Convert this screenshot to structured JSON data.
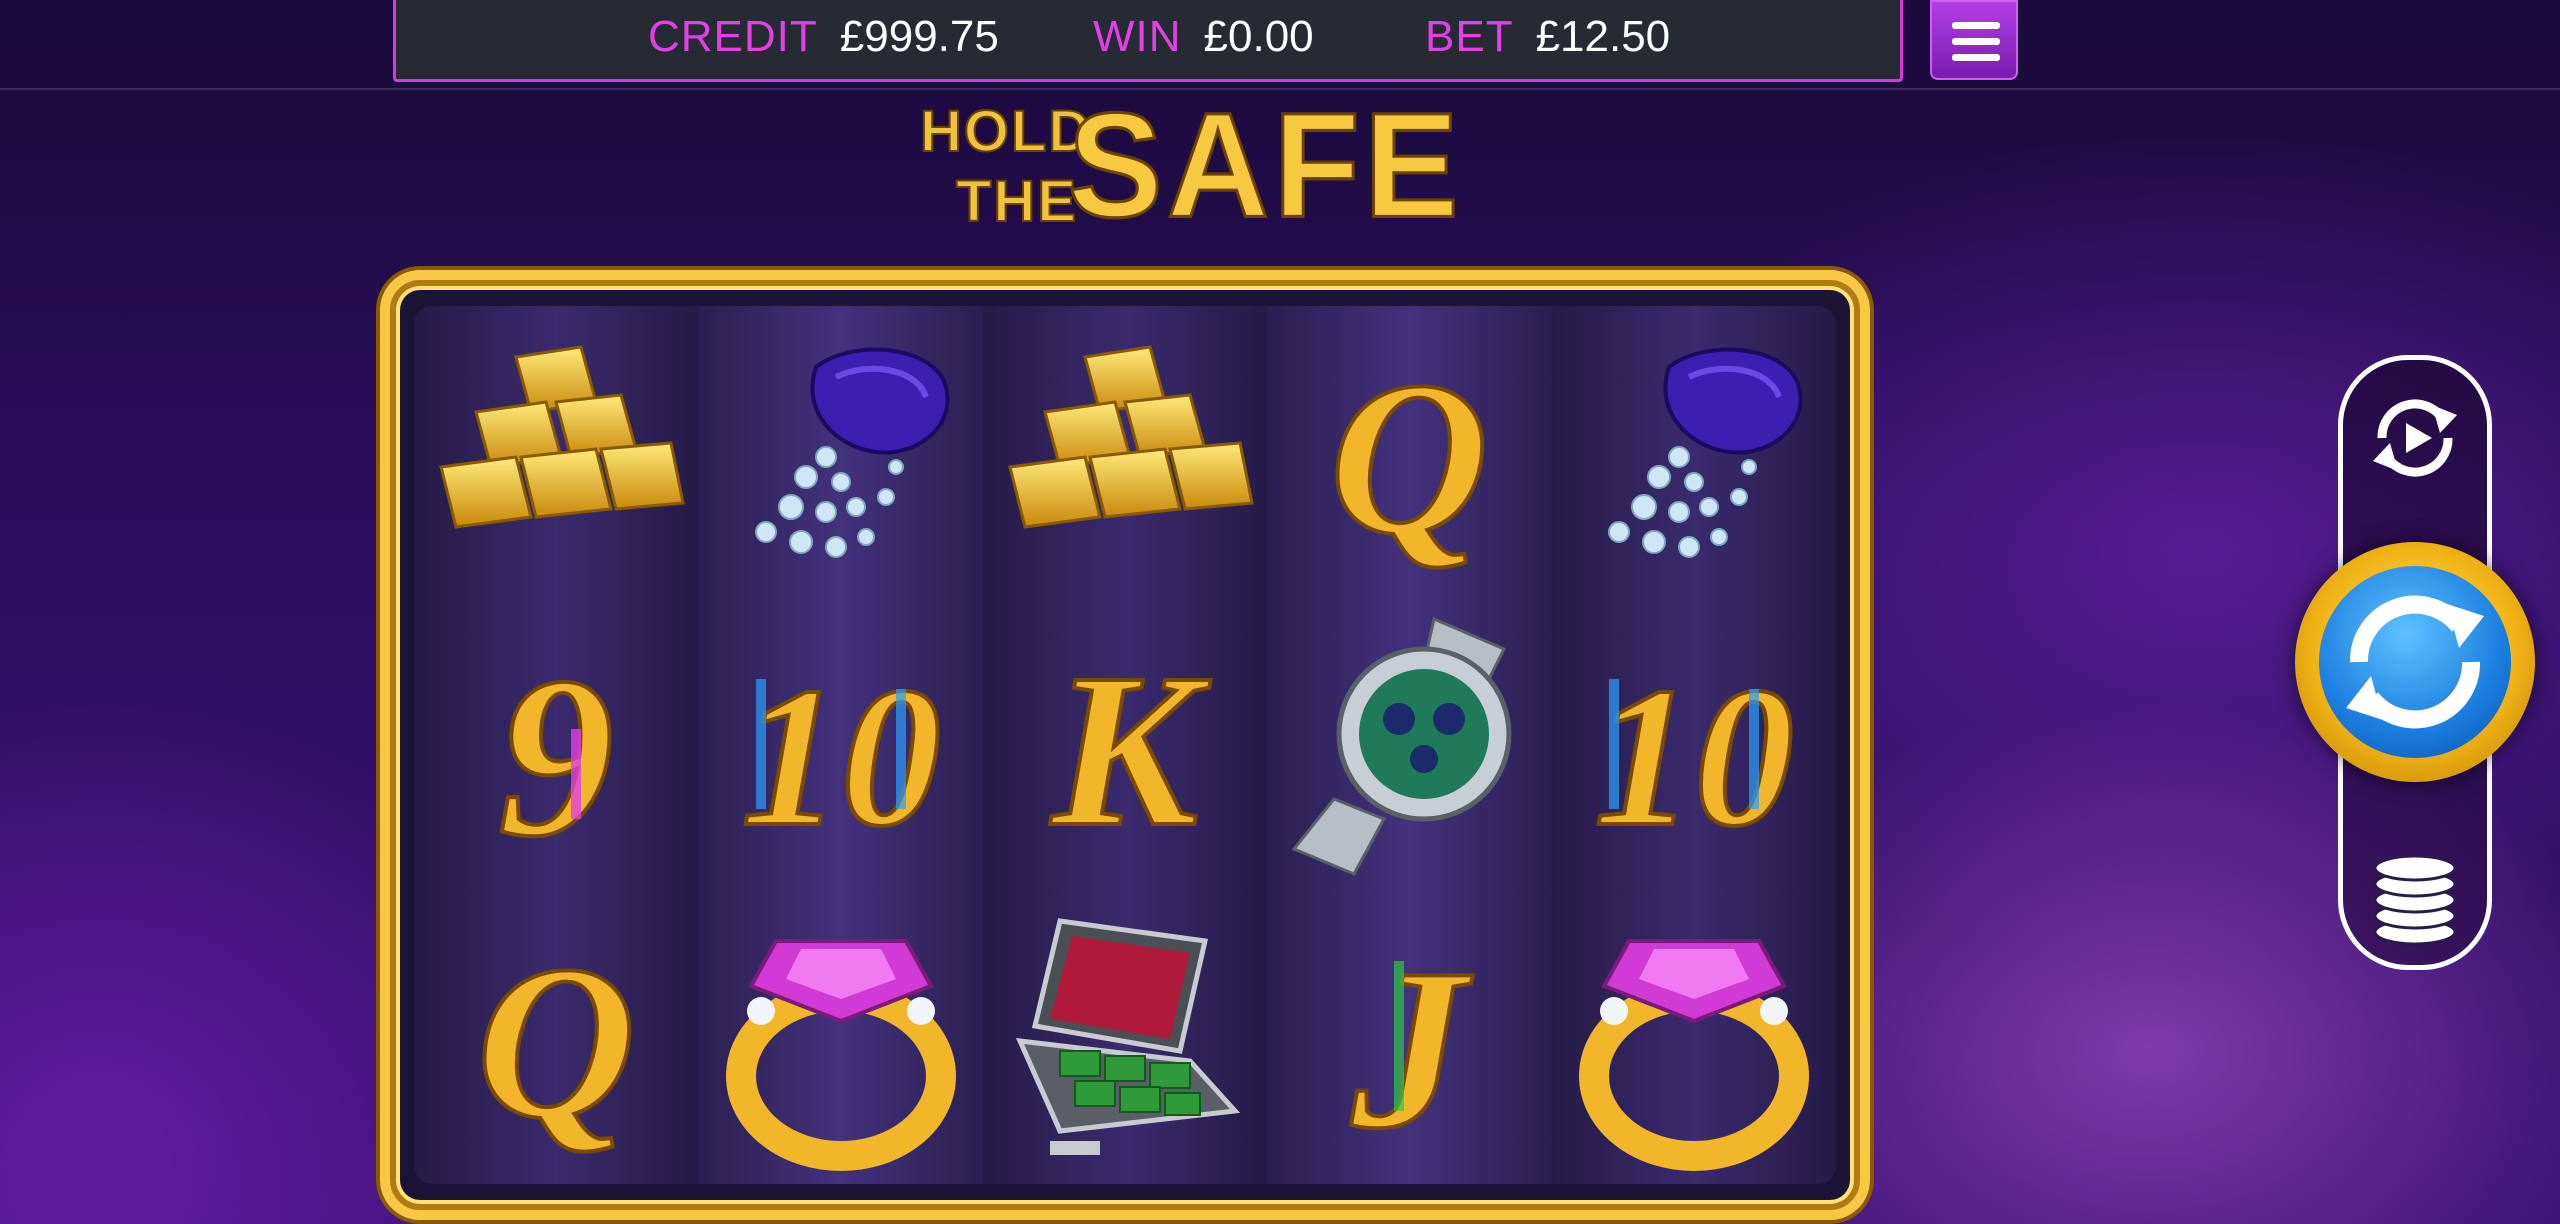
{
  "hud": {
    "credit_label": "CREDIT",
    "credit_value": "£999.75",
    "win_label": "WIN",
    "win_value": "£0.00",
    "bet_label": "BET",
    "bet_value": "£12.50"
  },
  "logo": {
    "line1": "HOLD",
    "line2": "THE",
    "word": "SAFE"
  },
  "reels": [
    [
      "gold-bars",
      "9",
      "Q"
    ],
    [
      "diamond-bag",
      "10",
      "ring"
    ],
    [
      "gold-bars",
      "K",
      "cash-briefcase"
    ],
    [
      "Q",
      "watch",
      "J"
    ],
    [
      "diamond-bag",
      "10",
      "ring"
    ]
  ],
  "controls": {
    "autoplay_icon": "autoplay-icon",
    "spin_icon": "spin-icon",
    "bet_icon": "coin-stack-icon",
    "menu_icon": "hamburger-menu-icon"
  },
  "colors": {
    "accent_magenta": "#e23fe6",
    "frame_gold": "#f7c844",
    "spin_blue": "#1a7ee0"
  }
}
